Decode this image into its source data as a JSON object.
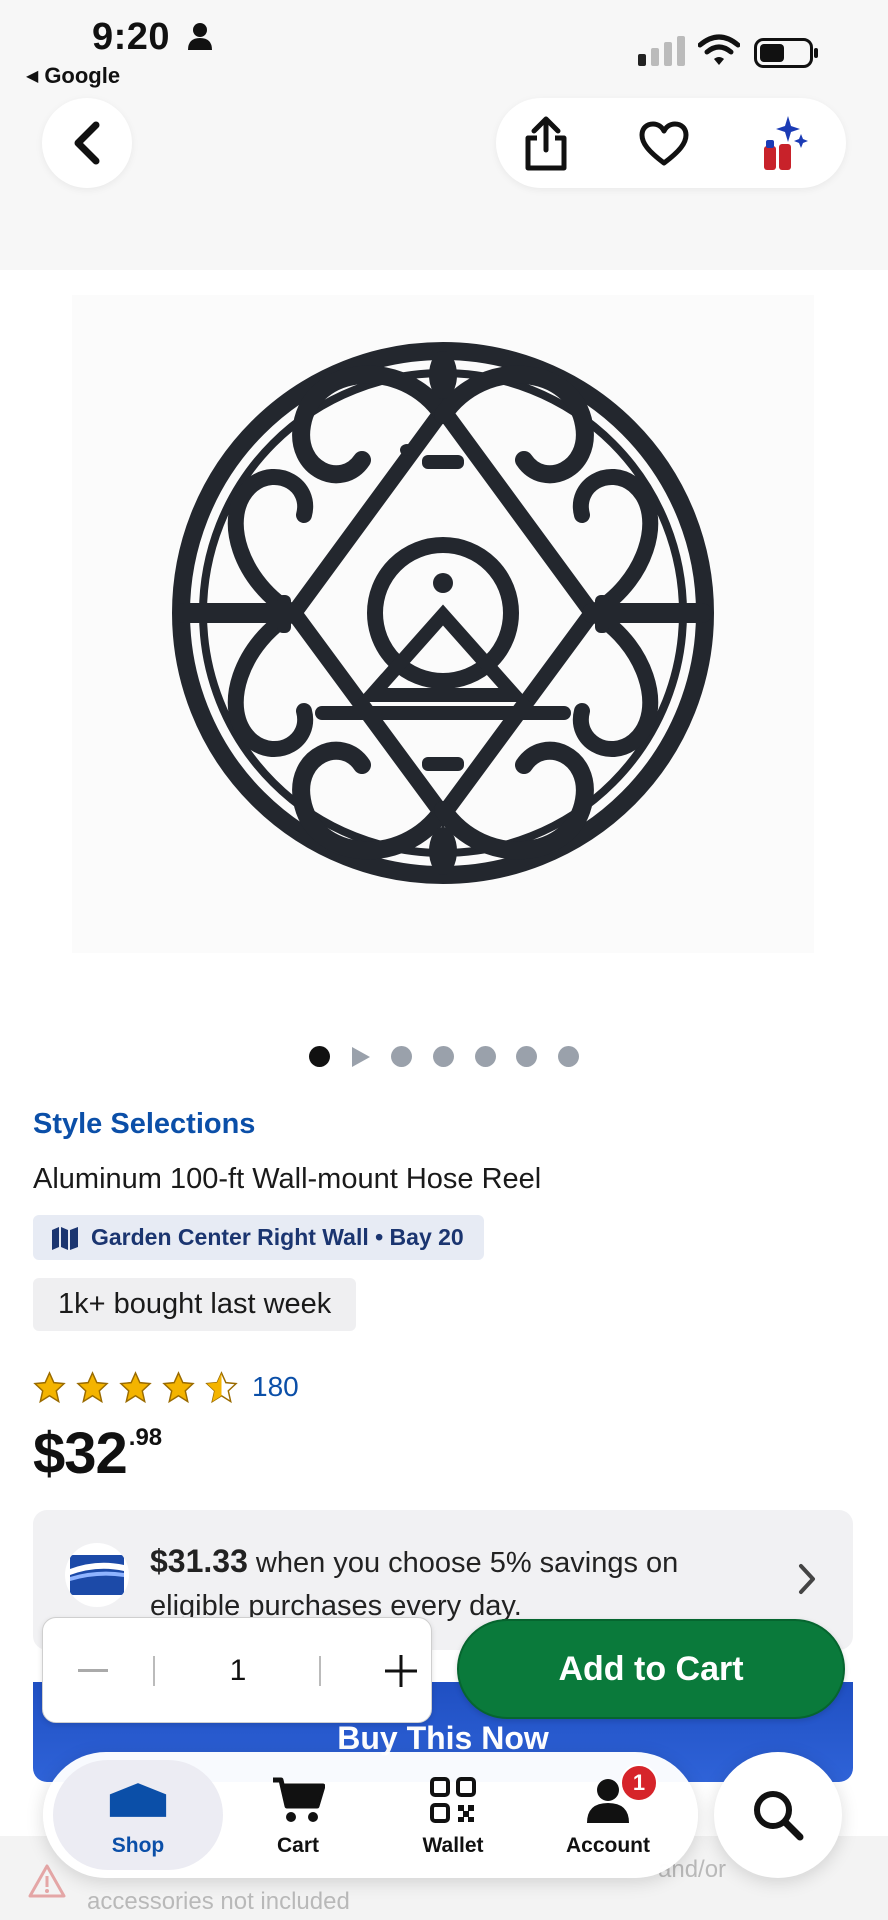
{
  "status_bar": {
    "time": "9:20",
    "back_app": "Google"
  },
  "product": {
    "brand": "Style Selections",
    "title": "Aluminum 100-ft Wall-mount Hose Reel",
    "aisle": "Garden Center Right Wall • Bay 20",
    "bought": "1k+ bought last week",
    "rating": 4.5,
    "review_count": "180",
    "price_dollars": "$32",
    "price_cents": ".98",
    "image_count": 7,
    "current_image": 1
  },
  "promo": {
    "price": "$31.33",
    "text": " when you choose 5% savings on eligible purchases every day."
  },
  "quantity": {
    "value": "1"
  },
  "actions": {
    "add_to_cart": "Add to Cart",
    "buy_now": "Buy This Now"
  },
  "disclaimer": {
    "line1_end": "and/or",
    "line2": "accessories not included"
  },
  "tabbar": {
    "shop": "Shop",
    "cart": "Cart",
    "wallet": "Wallet",
    "account": "Account",
    "account_badge": "1"
  },
  "colors": {
    "brand_blue": "#0b4fa8",
    "add_to_cart_green": "#0a7a3b",
    "buy_now_blue": "#2f63d8",
    "star_gold": "#f4b400",
    "badge_red": "#d6242a"
  }
}
